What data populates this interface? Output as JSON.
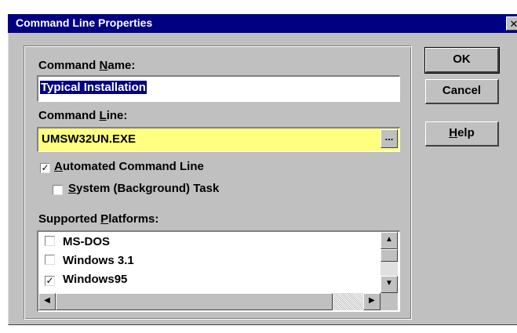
{
  "window": {
    "title": "Command Line Properties",
    "close_glyph": "✕"
  },
  "form": {
    "command_name_label_pre": "Command ",
    "command_name_label_accel": "N",
    "command_name_label_post": "ame:",
    "command_name_value": "Typical Installation",
    "command_line_label_pre": "Command ",
    "command_line_label_accel": "L",
    "command_line_label_post": "ine:",
    "command_line_value": "UMSW32UN.EXE",
    "browse_label": "...",
    "automated_label_accel": "A",
    "automated_label_post": "utomated Command Line",
    "automated_checked": true,
    "system_label_accel": "S",
    "system_label_post": "ystem (Background) Task",
    "system_checked": false,
    "platforms_label_pre": "Supported ",
    "platforms_label_accel": "P",
    "platforms_label_post": "latforms:",
    "platforms": [
      {
        "label": "MS-DOS",
        "checked": false
      },
      {
        "label": "Windows 3.1",
        "checked": false
      },
      {
        "label": "Windows95",
        "checked": true
      }
    ],
    "check_mark": "✓"
  },
  "buttons": {
    "ok": "OK",
    "cancel": "Cancel",
    "help_accel": "H",
    "help_post": "elp"
  },
  "scroll_glyphs": {
    "up": "▲",
    "down": "▼",
    "left": "◀",
    "right": "▶"
  }
}
